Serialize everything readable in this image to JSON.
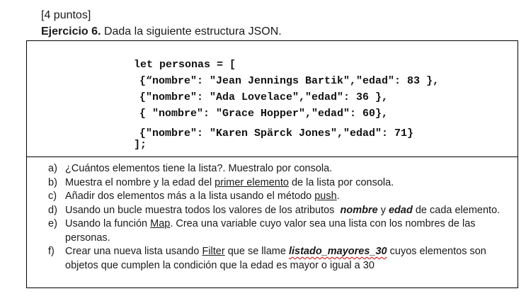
{
  "header": {
    "points": "[4 puntos]",
    "exercise_label": "Ejercicio 6.",
    "exercise_text": " Dada la siguiente estructura JSON."
  },
  "code": {
    "line1": "let personas = [",
    "line2": "{“nombre\": \"Jean Jennings Bartik\",\"edad\": 83 },",
    "line3": "{\"nombre\": \"Ada Lovelace\",\"edad\": 36 },",
    "line4": "{ \"nombre\": \"Grace Hopper\",\"edad\": 60},",
    "line5": "{\"nombre\": \"Karen Spärck Jones\",\"edad\": 71}",
    "line6": "];"
  },
  "questions": {
    "a": {
      "letter": "a)",
      "text": "¿Cuántos elementos tiene la lista?. Muestralo por consola."
    },
    "b": {
      "letter": "b)",
      "t1": "Muestra el nombre y la edad del ",
      "u1": "primer elemento",
      "t2": " de la lista por consola."
    },
    "c": {
      "letter": "c)",
      "t1": "Añadir dos elementos más a la lista usando el método ",
      "u1": "push",
      "t2": "."
    },
    "d": {
      "letter": "d)",
      "t1": "Usando un bucle muestra todos los valores de los atributos  ",
      "b1": "nombre",
      "t2": " y ",
      "b2": "edad",
      "t3": " de cada elemento."
    },
    "e": {
      "letter": "e)",
      "t1": "Usando la función ",
      "u1": "Map",
      "t2": ". Crea una variable cuyo valor sea una lista con los nombres de las personas."
    },
    "f": {
      "letter": "f)",
      "t1": "Crear una nueva lista usando ",
      "u1": "Filter",
      "t2": " que se llame ",
      "b1": "listado_mayores_30",
      "t3": " cuyos elementos son objetos que cumplen la condición que la edad es mayor o igual a 30"
    }
  }
}
